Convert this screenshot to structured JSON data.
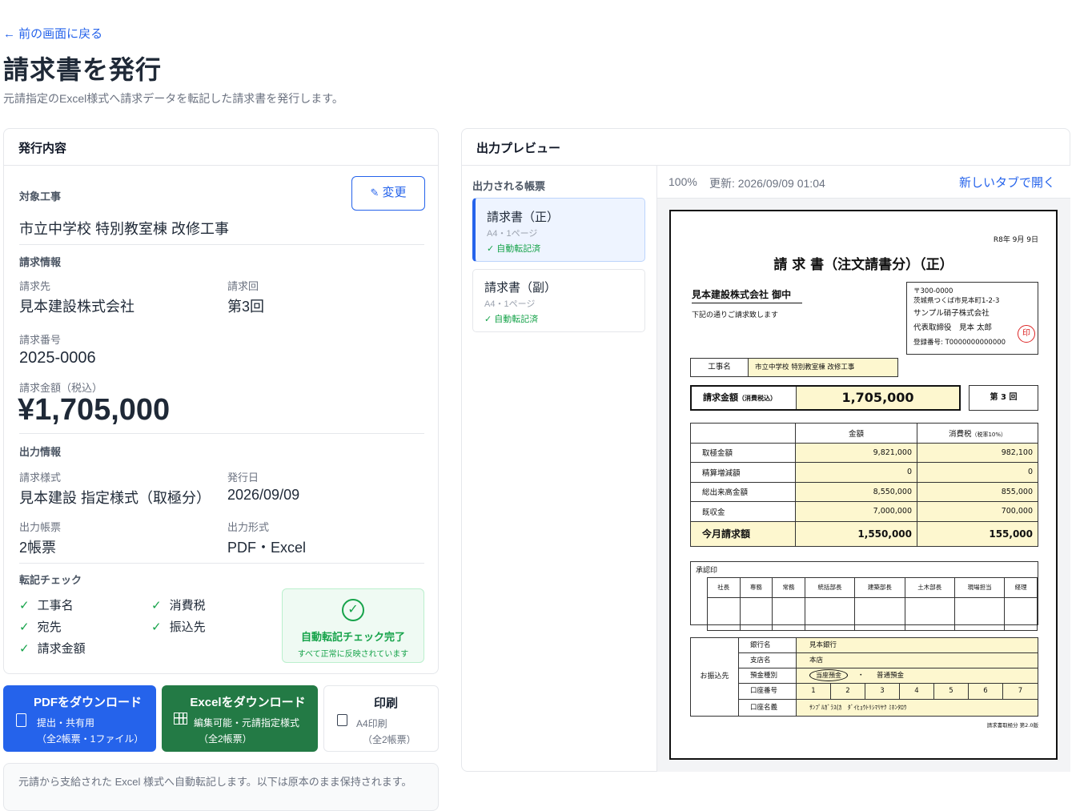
{
  "nav": {
    "back_label": "← 前の画面に戻る"
  },
  "page": {
    "title": "請求書を発行",
    "subtitle": "元請指定のExcel様式へ請求データを転記した請求書を発行します。"
  },
  "issue": {
    "header": "発行内容",
    "project_label": "対象工事",
    "project_value": "市立中学校 特別教室棟 改修工事",
    "change_button": "変更",
    "billing_section": "請求情報",
    "recipient_label": "請求先",
    "recipient_value": "見本建設株式会社",
    "round_label": "請求回",
    "round_value": "第3回",
    "number_label": "請求番号",
    "number_value": "2025-0006",
    "amount_label": "請求金額（税込）",
    "amount_value": "¥1,705,000",
    "output_section": "出力情報",
    "format_label": "請求様式",
    "format_value": "見本建設 指定様式（取極分）",
    "date_label": "発行日",
    "date_value": "2026/09/09",
    "forms_label": "出力帳票",
    "forms_value": "2帳票",
    "type_label": "出力形式",
    "type_value": "PDF・Excel",
    "check_section": "転記チェック",
    "checks": [
      "工事名",
      "消費税",
      "宛先",
      "振込先",
      "請求金額"
    ],
    "check_done_title": "自動転記チェック完了",
    "check_done_sub": "すべて正常に反映されています"
  },
  "actions": {
    "pdf": {
      "title": "PDFをダウンロード",
      "line1": "提出・共有用",
      "line2": "（全2帳票・1ファイル）"
    },
    "excel": {
      "title": "Excelをダウンロード",
      "line1": "編集可能・元請指定様式",
      "line2": "（全2帳票）"
    },
    "print": {
      "title": "印刷",
      "line1": "A4印刷",
      "line2": "（全2帳票）"
    }
  },
  "note": {
    "text": "元請から支給された Excel 様式へ自動転記します。以下は原本のまま保持されます。"
  },
  "preview": {
    "header": "出力プレビュー",
    "list_label": "出力される帳票",
    "docs": [
      {
        "name": "請求書（正）",
        "meta": "A4・1ページ",
        "status": "✓ 自動転記済"
      },
      {
        "name": "請求書（副）",
        "meta": "A4・1ページ",
        "status": "✓ 自動転記済"
      }
    ],
    "zoom": "100%",
    "updated": "更新: 2026/09/09 01:04",
    "open_tab": "新しいタブで開く"
  },
  "invoice": {
    "date": "R8年  9月  9日",
    "title": "請 求 書（注文請書分）（正）",
    "to": "見本建設株式会社  御中",
    "greeting": "下記の通りご請求致します",
    "sender": {
      "zip": "〒300-0000",
      "address": "茨城県つくば市見本町1-2-3",
      "company": "サンプル硝子株式会社",
      "rep": "代表取締役　見本  太郎",
      "reg": "登録番号: T0000000000000",
      "seal": "印"
    },
    "project_label": "工事名",
    "project": "市立中学校 特別教室棟 改修工事",
    "amount_label": "請求金額",
    "amount_note": "（消費税込）",
    "amount": "1,705,000",
    "round": "第  3  回",
    "col_amount": "金額",
    "col_tax": "消費税",
    "col_tax_note": "（税率10%）",
    "rows": [
      {
        "label": "取極金額",
        "amount": "9,821,000",
        "tax": "982,100"
      },
      {
        "label": "精算増減額",
        "amount": "0",
        "tax": "0"
      },
      {
        "label": "総出来高金額",
        "amount": "8,550,000",
        "tax": "855,000"
      },
      {
        "label": "既収金",
        "amount": "7,000,000",
        "tax": "700,000"
      }
    ],
    "total": {
      "label": "今月請求額",
      "amount": "1,550,000",
      "tax": "155,000"
    },
    "approval_label": "承認印",
    "approvers": [
      "社長",
      "専務",
      "常務",
      "統括部長",
      "建築部長",
      "土木部長",
      "現場担当",
      "経理"
    ],
    "bank": {
      "label": "お振込先",
      "bank_label": "銀行名",
      "bank": "見本銀行",
      "branch_label": "支店名",
      "branch": "本店",
      "kind_label": "預金種別",
      "kind1": "当座預金",
      "kind_sep": "・",
      "kind2": "普通預金",
      "number_label": "口座番号",
      "digits": [
        "1",
        "2",
        "3",
        "4",
        "5",
        "6",
        "7"
      ],
      "name_label": "口座名義",
      "name": "ｻﾝﾌﾟﾙｶﾞﾗｽ(ｶ　ﾀﾞｲﾋｮｳﾄﾘｼﾏﾘﾔｸ ﾐﾎﾝﾀﾛｳ"
    },
    "footer": "請求書取極分 第2.0版"
  }
}
